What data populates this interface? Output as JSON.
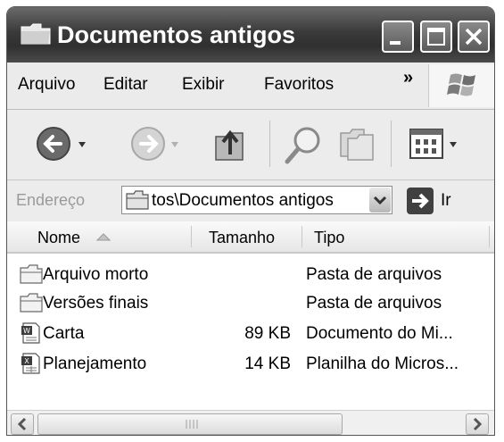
{
  "window": {
    "title": "Documentos antigos"
  },
  "menu": {
    "items": [
      "Arquivo",
      "Editar",
      "Exibir",
      "Favoritos"
    ],
    "more": "»"
  },
  "address": {
    "label": "Endereço",
    "value": "tos\\Documentos antigos",
    "go_label": "Ir"
  },
  "columns": {
    "name": "Nome",
    "size": "Tamanho",
    "type": "Tipo"
  },
  "files": [
    {
      "name": "Arquivo morto",
      "size": "",
      "type": "Pasta de arquivos",
      "icon": "folder-icon"
    },
    {
      "name": "Versões finais",
      "size": "",
      "type": "Pasta de arquivos",
      "icon": "folder-icon"
    },
    {
      "name": "Carta",
      "size": "89 KB",
      "type": "Documento do Mi...",
      "icon": "word-document-icon"
    },
    {
      "name": "Planejamento",
      "size": "14 KB",
      "type": "Planilha do Micros...",
      "icon": "excel-spreadsheet-icon"
    }
  ]
}
